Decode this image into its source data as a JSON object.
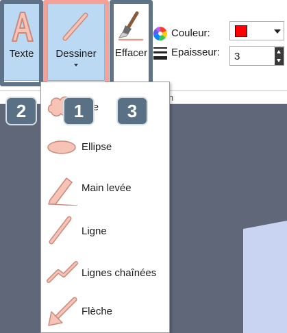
{
  "ribbon": {
    "texte_label": "Texte",
    "dessiner_label": "Dessiner",
    "effacer_label": "Effacer",
    "couleur_label": "Couleur:",
    "epaisseur_label": "Epaisseur:",
    "couleur_value": "#ff0000",
    "epaisseur_value": "3",
    "tab_fragment": "n"
  },
  "menu": {
    "items": [
      {
        "label": "age",
        "icon": "cloud-shape-icon"
      },
      {
        "label": "Ellipse",
        "icon": "ellipse-icon"
      },
      {
        "label": "Main levée",
        "icon": "freehand-icon"
      },
      {
        "label": "Ligne",
        "icon": "line-icon"
      },
      {
        "label": "Lignes chaînées",
        "icon": "polyline-icon"
      },
      {
        "label": "Flèche",
        "icon": "arrow-icon"
      }
    ]
  },
  "badges": {
    "dessiner": "1",
    "texte": "2",
    "effacer": "3"
  },
  "colors": {
    "highlight_slate": "#5e7388",
    "highlight_salmon": "#f4a198",
    "badge_fill": "#5a7185",
    "selected_button": "#bcd9f3",
    "shape_fill": "#f7c3b6",
    "shape_stroke": "#c98a7c",
    "canvas_bg": "#5f6779"
  }
}
